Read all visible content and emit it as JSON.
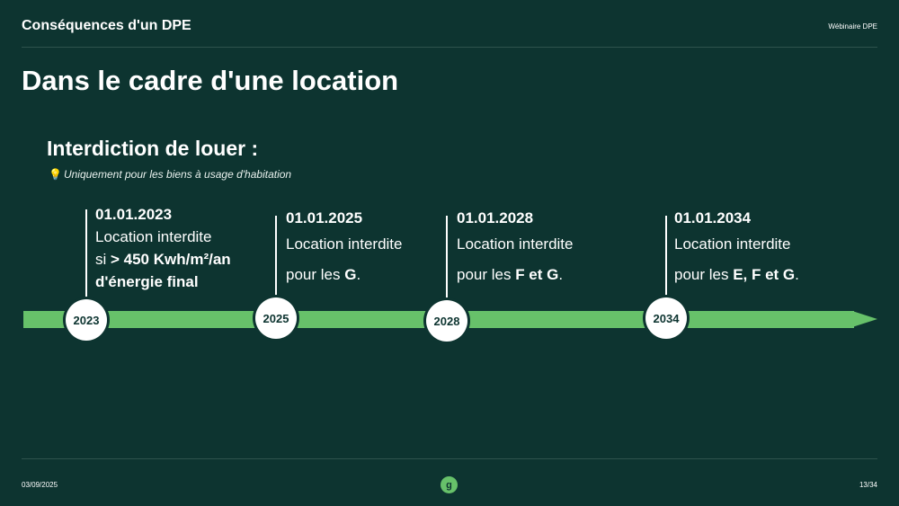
{
  "header": {
    "title": "Conséquences d'un DPE",
    "right_label": "Wébinaire DPE"
  },
  "main": {
    "title": "Dans le cadre d'une location",
    "section_title": "Interdiction de louer :",
    "note": "Uniquement pour les biens à usage d'habitation",
    "note_icon": "lightbulb-icon"
  },
  "timeline": {
    "milestones": [
      {
        "year": "2023",
        "date": "01.01.2023",
        "line1": "Location interdite",
        "line2_prefix": "si ",
        "line2_bold": "> 450 Kwh/m²/an",
        "line3_bold": "d'énergie final"
      },
      {
        "year": "2025",
        "date": "01.01.2025",
        "line1": "Location interdite",
        "line2_prefix": "pour les ",
        "line2_bold": "G",
        "line2_suffix": "."
      },
      {
        "year": "2028",
        "date": "01.01.2028",
        "line1": "Location interdite",
        "line2_prefix": "pour les ",
        "line2_bold": "F et G",
        "line2_suffix": "."
      },
      {
        "year": "2034",
        "date": "01.01.2034",
        "line1": "Location interdite",
        "line2_prefix": "pour les ",
        "line2_bold": "E, F et G",
        "line2_suffix": "."
      }
    ]
  },
  "footer": {
    "date": "03/09/2025",
    "page": "13/34",
    "logo_letter": "g"
  },
  "colors": {
    "background": "#0d3430",
    "accent_green": "#67c16a",
    "white": "#ffffff"
  }
}
